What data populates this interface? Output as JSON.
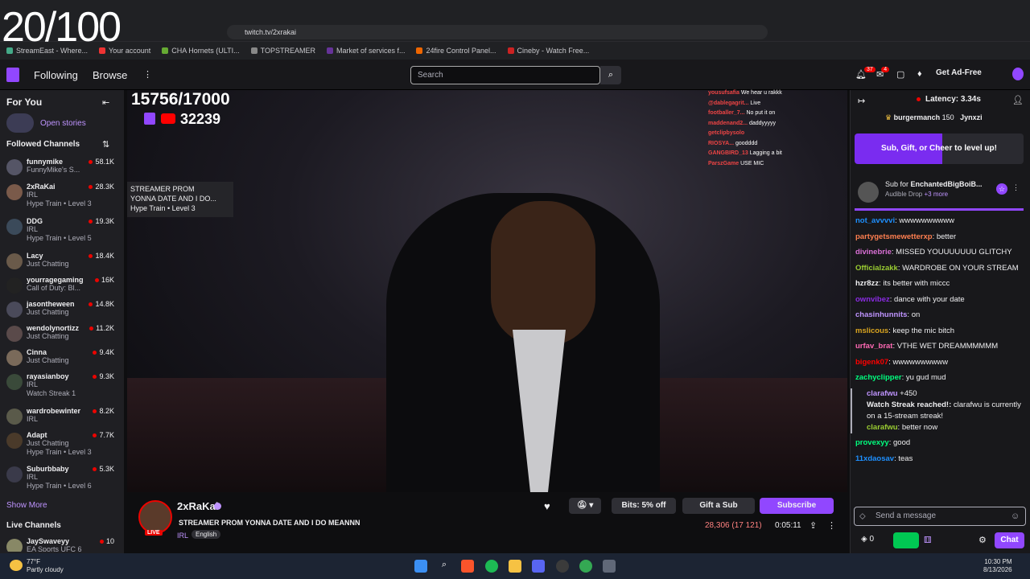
{
  "overlay": {
    "counter": "20/100"
  },
  "browser": {
    "url": "twitch.tv/2xrakai",
    "bookmarks": [
      "StreamEast - Where...",
      "Your account",
      "CHA Hornets (ULTI...",
      "TOPSTREAMER",
      "Market of services f...",
      "24fire Control Panel...",
      "Cineby - Watch Free..."
    ]
  },
  "nav": {
    "following": "Following",
    "browse": "Browse",
    "search_placeholder": "Search",
    "notif_count": "37",
    "inbox_count": "4",
    "ad_free": "Get Ad-Free"
  },
  "sidebar": {
    "for_you": "For You",
    "open_stories": "Open stories",
    "followed_title": "Followed Channels",
    "channels": [
      {
        "name": "funnymike",
        "game": "FunnyMike's S...",
        "viewers": "58.1K",
        "extra": ""
      },
      {
        "name": "2xRaKai",
        "game": "IRL",
        "viewers": "28.3K",
        "extra": "Hype Train • Level 3"
      },
      {
        "name": "DDG",
        "game": "IRL",
        "viewers": "19.3K",
        "extra": "Hype Train • Level 5"
      },
      {
        "name": "Lacy",
        "game": "Just Chatting",
        "viewers": "18.4K",
        "extra": ""
      },
      {
        "name": "yourragegaming",
        "game": "Call of Duty: Bl...",
        "viewers": "16K",
        "extra": ""
      },
      {
        "name": "jasontheween",
        "game": "Just Chatting",
        "viewers": "14.8K",
        "extra": ""
      },
      {
        "name": "wendolynortizz",
        "game": "Just Chatting",
        "viewers": "11.2K",
        "extra": ""
      },
      {
        "name": "Cinna",
        "game": "Just Chatting",
        "viewers": "9.4K",
        "extra": ""
      },
      {
        "name": "rayasianboy",
        "game": "IRL",
        "viewers": "9.3K",
        "extra": "Watch Streak 1"
      },
      {
        "name": "wardrobewinter",
        "game": "IRL",
        "viewers": "8.2K",
        "extra": ""
      },
      {
        "name": "Adapt",
        "game": "Just Chatting",
        "viewers": "7.7K",
        "extra": "Hype Train • Level 3"
      },
      {
        "name": "Suburbbaby",
        "game": "IRL",
        "viewers": "5.3K",
        "extra": "Hype Train • Level 6"
      }
    ],
    "show_more": "Show More",
    "live_channels": "Live Channels",
    "live_first": {
      "name": "JaySwaveyy",
      "game": "EA Sports UFC 6",
      "viewers": "10"
    }
  },
  "video": {
    "goal": "15756/17000",
    "yt_viewers": "32239",
    "notification": {
      "line1": "STREAMER PROM",
      "line2": "YONNA DATE",
      "line3": "AND I DO...",
      "line4": "Hype Train • Level 3"
    },
    "onscreen_chat": [
      {
        "user": "yousufsafia",
        "msg": "We hear u rakkk"
      },
      {
        "user": "@dablegagrit...",
        "msg": "Live"
      },
      {
        "user": "footballer_7...",
        "msg": "No put it on"
      },
      {
        "user": "maddenand2...",
        "msg": "daddyyyyy"
      },
      {
        "user": "getclipbysolo",
        "msg": ""
      },
      {
        "user": "RIOSYA...",
        "msg": "goodddd"
      },
      {
        "user": "GANGBIRD_13",
        "msg": "Lagging a bit"
      },
      {
        "user": "ParszGame",
        "msg": "USE MIC"
      }
    ]
  },
  "stream": {
    "channel": "2xRaKai",
    "live": "LIVE",
    "title": "STREAMER PROM YONNA DATE AND I DO MEANNN",
    "category": "IRL",
    "language": "English",
    "bits": "Bits: 5% off",
    "gift": "Gift a Sub",
    "subscribe": "Subscribe",
    "viewers": "28,306 (17 121)",
    "uptime": "0:05:11"
  },
  "chat": {
    "latency": "Latency: 3.34s",
    "leader1": "burgermanch",
    "leader1_amt": "150",
    "leader2": "Jynxzi",
    "level_up": "Sub, Gift, or Cheer to level up!",
    "hype_sub": "Sub for",
    "hype_user": "EnchantedBigBoiB...",
    "hype_drop": "Audible Drop",
    "hype_more": "+3 more",
    "messages": [
      {
        "user": "not_avvvvi",
        "color": "#1e90ff",
        "msg": "wwwwwwwwww"
      },
      {
        "user": "partygetsmewetterxp",
        "color": "#ff7f50",
        "msg": "better"
      },
      {
        "user": "divinebrie",
        "color": "#da70d6",
        "msg": "MISSED YOUUUUUUU GLITCHY"
      },
      {
        "user": "Officialzakk",
        "color": "#9acd32",
        "msg": "WARDROBE ON YOUR STREAM"
      },
      {
        "user": "hzr8zz",
        "color": "#efeff1",
        "msg": "its better with miccc"
      },
      {
        "user": "ownvibez",
        "color": "#8a2be2",
        "msg": "dance with your date"
      },
      {
        "user": "chasinhunnits",
        "color": "#bf94ff",
        "msg": "on"
      },
      {
        "user": "mslicous",
        "color": "#daa520",
        "msg": "keep the mic bitch"
      },
      {
        "user": "urfav_brat",
        "color": "#ff69b4",
        "msg": "VTHE WET DREAMMMMMM"
      },
      {
        "user": "bigenk07",
        "color": "#ff0000",
        "msg": "wwwwwwwwww"
      },
      {
        "user": "zachyclipper",
        "color": "#00ff7f",
        "msg": "yu gud mud"
      }
    ],
    "streak_user": "clarafwu",
    "streak_amt": "450",
    "streak_title": "Watch Streak reached!:",
    "streak_text": "clarafwu is currently on a 15-stream streak!",
    "streak_msg_user": "clarafwu",
    "streak_msg": "better now",
    "after": [
      {
        "user": "provexyy",
        "color": "#00ff7f",
        "msg": "good"
      },
      {
        "user": "11xdaosav",
        "color": "#1e90ff",
        "msg": "teas"
      }
    ],
    "input_placeholder": "Send a message",
    "points": "0",
    "chat_button": "Chat"
  },
  "taskbar": {
    "temp": "77°F",
    "weather": "Partly cloudy",
    "time": "10:30 PM",
    "date": "8/13/2026"
  }
}
